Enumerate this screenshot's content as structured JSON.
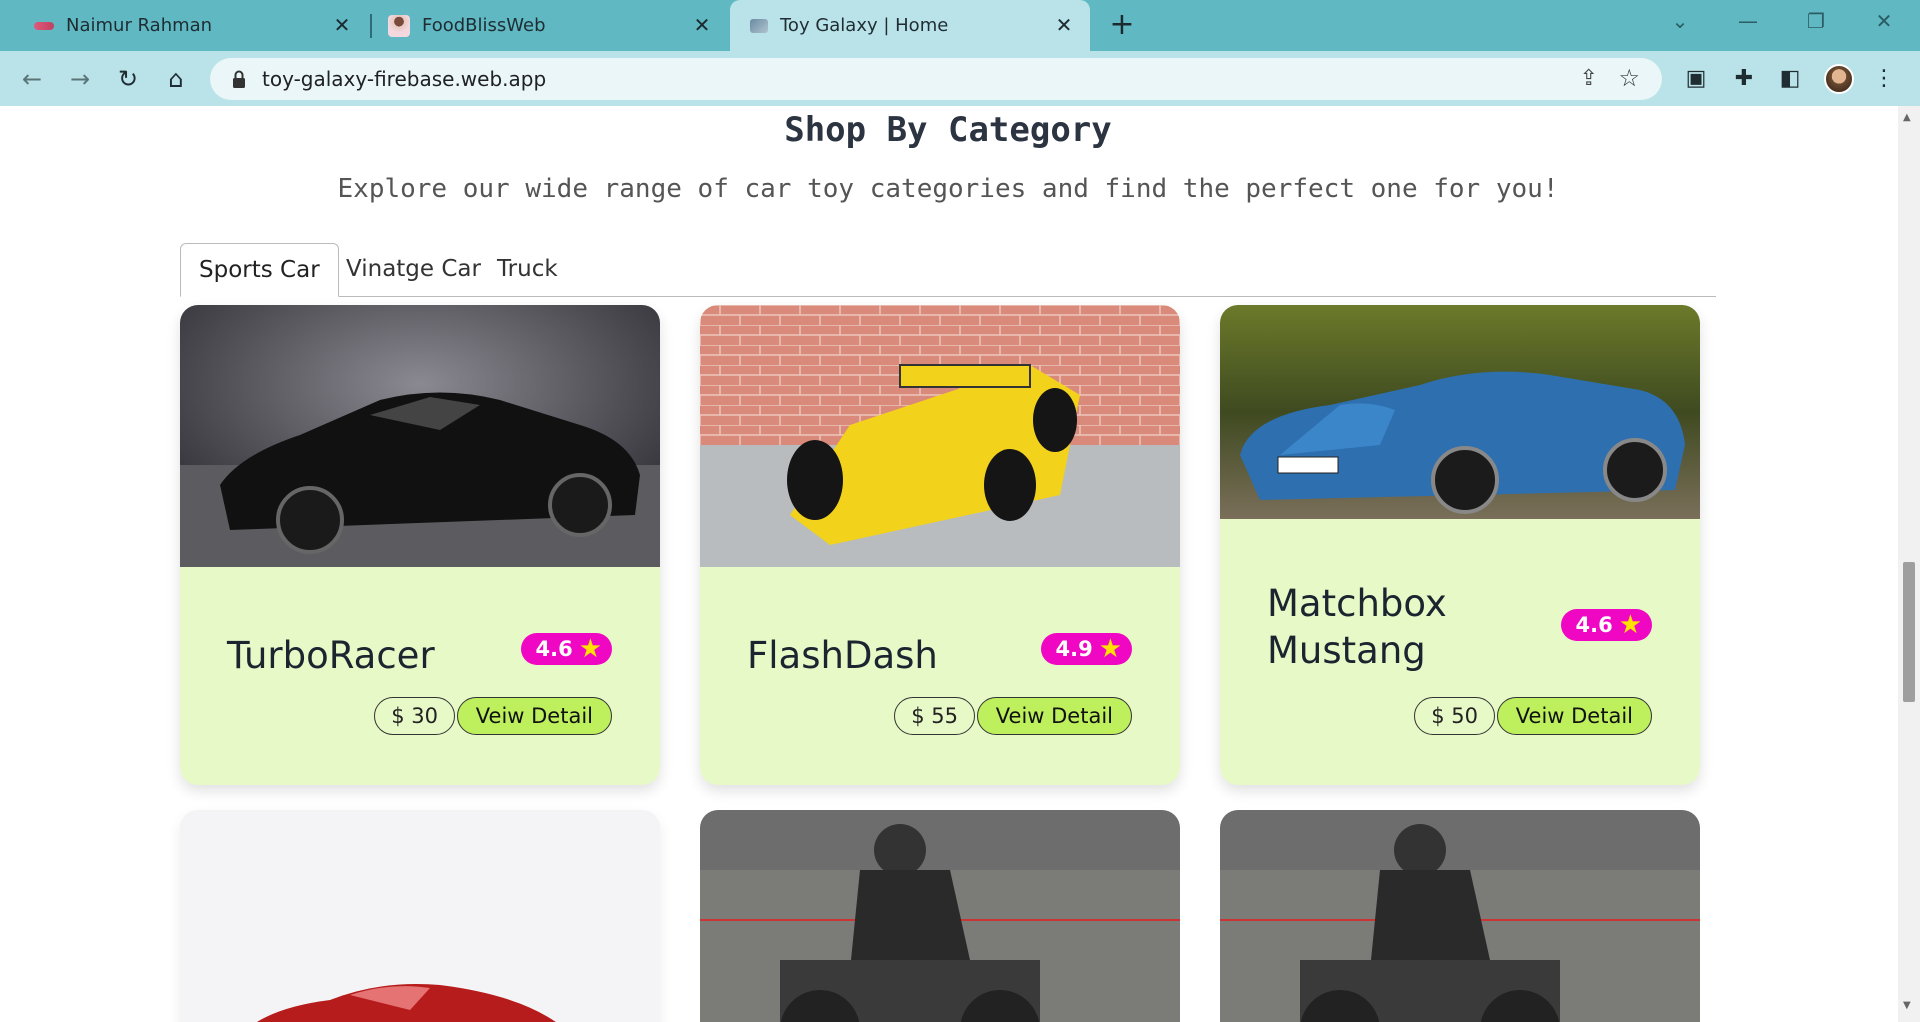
{
  "browser": {
    "tabs": [
      {
        "title": "Naimur Rahman"
      },
      {
        "title": "FoodBlissWeb"
      },
      {
        "title": "Toy Galaxy | Home",
        "active": true
      }
    ],
    "url": "toy-galaxy-firebase.web.app"
  },
  "section": {
    "title": "Shop By Category",
    "subtitle": "Explore our wide range of car toy categories and find the perfect one for you!"
  },
  "category_tabs": [
    {
      "label": "Sports Car",
      "active": true
    },
    {
      "label": "Vinatge Car"
    },
    {
      "label": "Truck"
    }
  ],
  "products": [
    {
      "name": "TurboRacer",
      "rating": "4.6",
      "price": "$ 30",
      "button": "Veiw Detail"
    },
    {
      "name": "FlashDash",
      "rating": "4.9",
      "price": "$ 55",
      "button": "Veiw Detail"
    },
    {
      "name": "Matchbox",
      "name2": "Mustang",
      "rating": "4.6",
      "price": "$ 50",
      "button": "Veiw Detail"
    }
  ],
  "colors": {
    "tabstrip": "#5fb8c2",
    "toolbar": "#b9e3e8",
    "card_bg": "#e8f9c8",
    "rating_badge": "#f007c4",
    "detail_button": "#bdf05c"
  }
}
